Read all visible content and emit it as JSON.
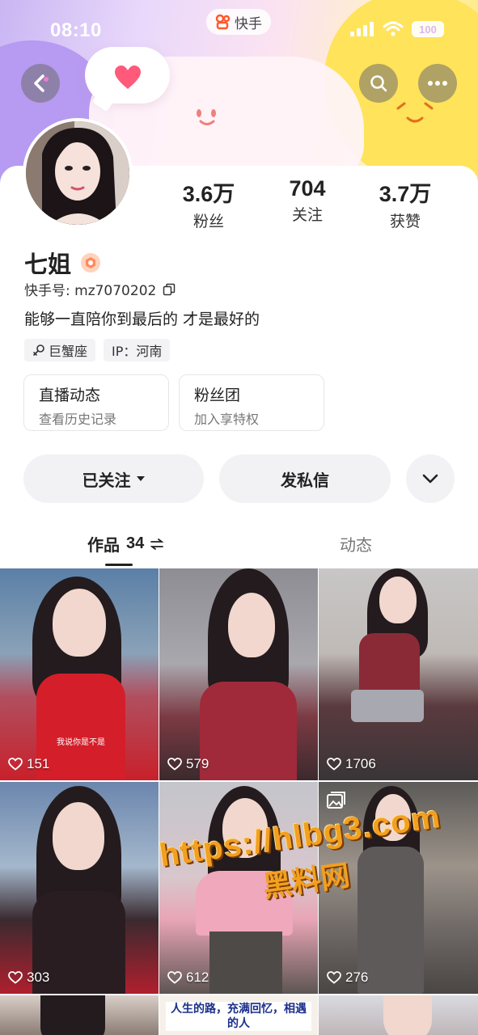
{
  "status_bar": {
    "time": "08:10",
    "app_name": "快手",
    "battery": "100"
  },
  "profile": {
    "name": "七姐",
    "id_label": "快手号: mz7070202",
    "bio": "能够一直陪你到最后的  才是最好的",
    "tags": [
      "巨蟹座",
      "IP：河南"
    ],
    "stats": [
      {
        "value": "3.6万",
        "label": "粉丝"
      },
      {
        "value": "704",
        "label": "关注"
      },
      {
        "value": "3.7万",
        "label": "获赞"
      }
    ]
  },
  "features": [
    {
      "title": "直播动态",
      "subtitle": "查看历史记录"
    },
    {
      "title": "粉丝团",
      "subtitle": "加入享特权"
    }
  ],
  "actions": {
    "follow": "已关注",
    "message": "发私信"
  },
  "tabs": {
    "works_label": "作品",
    "works_count": "34",
    "moments_label": "动态"
  },
  "videos": [
    {
      "likes": "151",
      "overlay": "我说你是不是"
    },
    {
      "likes": "579"
    },
    {
      "likes": "1706"
    },
    {
      "likes": "303"
    },
    {
      "likes": "612"
    },
    {
      "likes": "276"
    }
  ],
  "partial_caption": "人生的路，充满回忆，相遇的人",
  "watermark": {
    "url": "https://hlbg3.com",
    "cn": "黑料网"
  },
  "colors": {
    "accent_follow": "#f2f2f4",
    "watermark": "#f2a020"
  }
}
